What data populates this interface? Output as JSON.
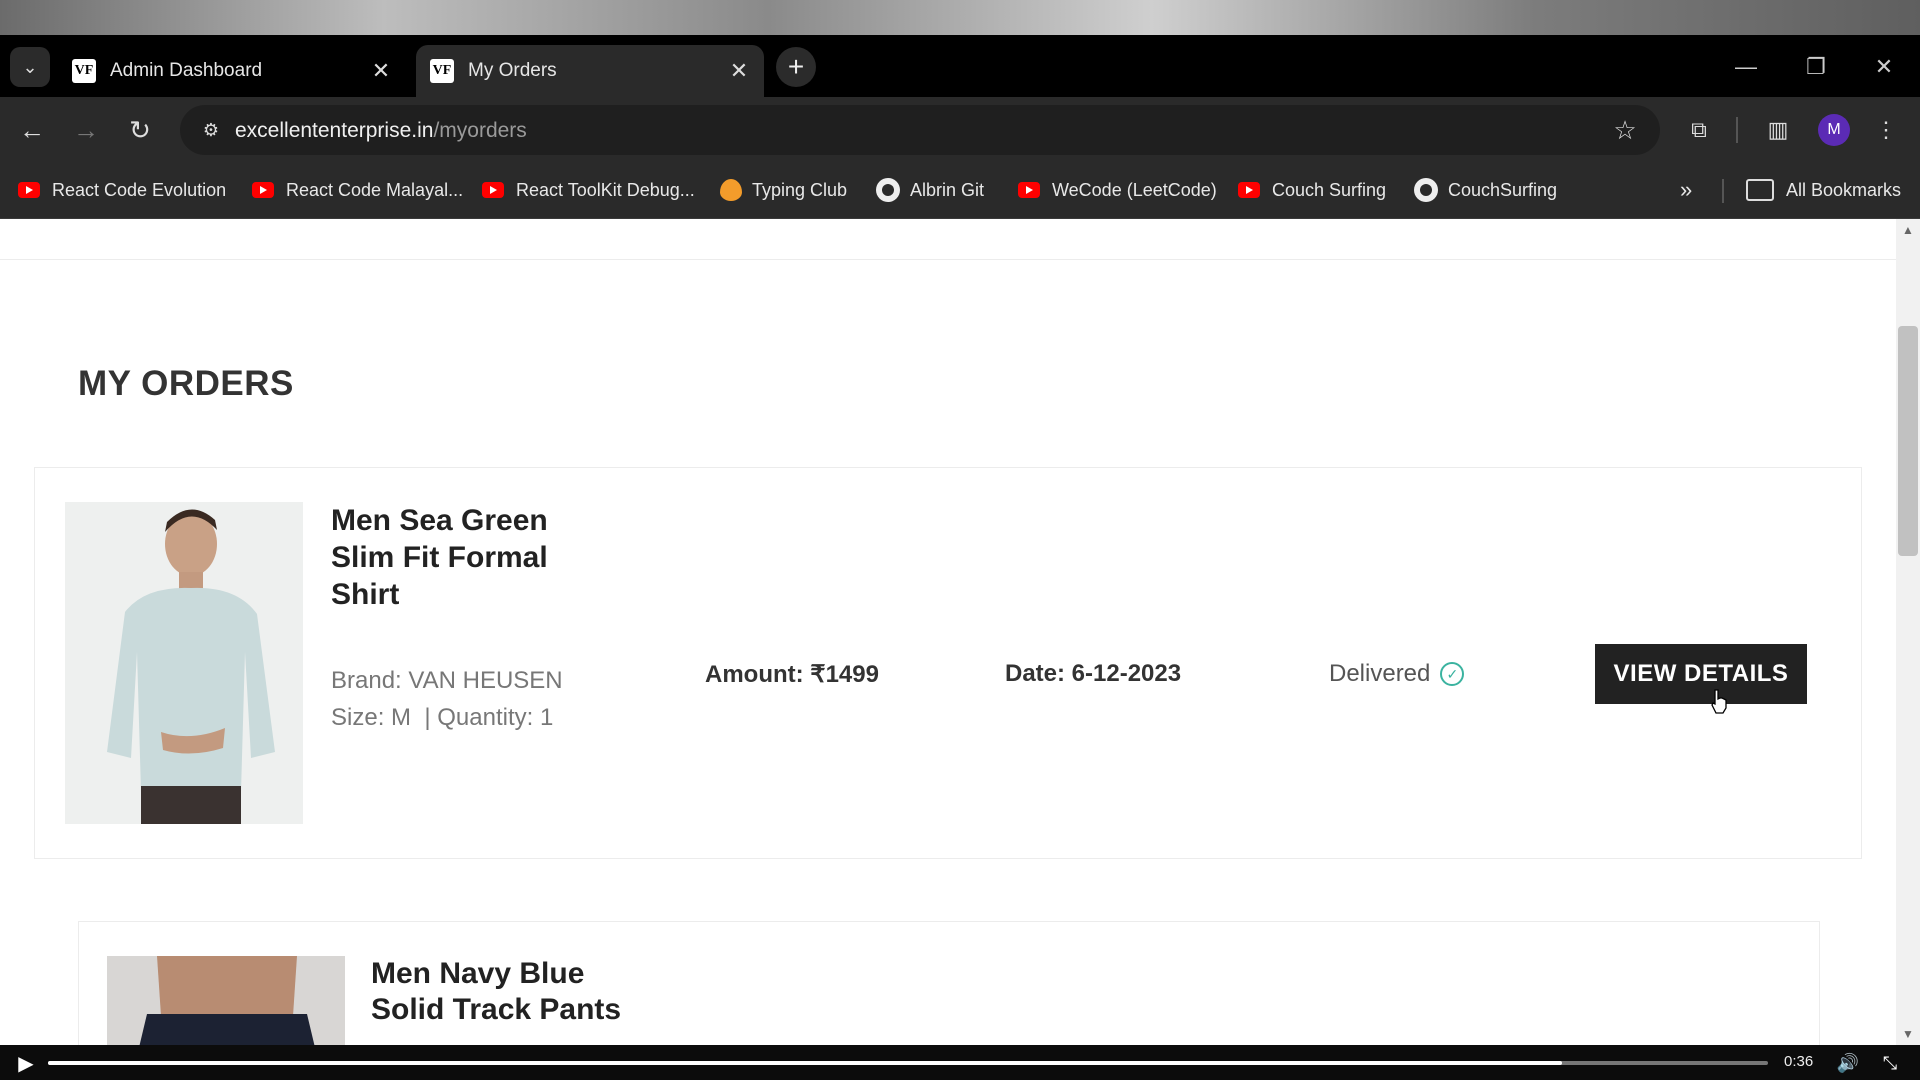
{
  "browser": {
    "tabs": [
      {
        "label": "Admin Dashboard",
        "favicon": "VF"
      },
      {
        "label": "My Orders",
        "favicon": "VF"
      }
    ],
    "url_host": "excellententerprise.in",
    "url_path": "/myorders",
    "profile_initial": "M",
    "bookmarks": [
      {
        "label": "React Code Evolution",
        "icon": "youtube-icon"
      },
      {
        "label": "React Code Malayal...",
        "icon": "youtube-icon"
      },
      {
        "label": "React ToolKit Debug...",
        "icon": "youtube-icon"
      },
      {
        "label": "Typing Club",
        "icon": "fire-icon"
      },
      {
        "label": "Albrin Git",
        "icon": "github-icon"
      },
      {
        "label": "WeCode (LeetCode)",
        "icon": "youtube-icon"
      },
      {
        "label": "Couch Surfing",
        "icon": "youtube-icon"
      },
      {
        "label": "CouchSurfing",
        "icon": "github-icon"
      }
    ],
    "all_bookmarks_label": "All Bookmarks"
  },
  "page": {
    "title": "MY ORDERS",
    "orders": [
      {
        "name_lines": [
          "Men Sea Green",
          "Slim Fit Formal",
          "Shirt"
        ],
        "brand": "Brand: VAN HEUSEN",
        "size_qty": "Size: M  | Quantity: 1",
        "amount": "Amount: ₹1499",
        "date": "Date: 6-12-2023",
        "status": "Delivered",
        "button": "VIEW DETAILS"
      },
      {
        "name_lines": [
          "Men Navy Blue",
          "Solid Track Pants"
        ]
      }
    ]
  },
  "video": {
    "time": "0:36",
    "progress": 0.88
  },
  "colors": {
    "accent_check": "#3bb3a0",
    "button_bg": "#222222",
    "profile": "#5b2bb5"
  }
}
